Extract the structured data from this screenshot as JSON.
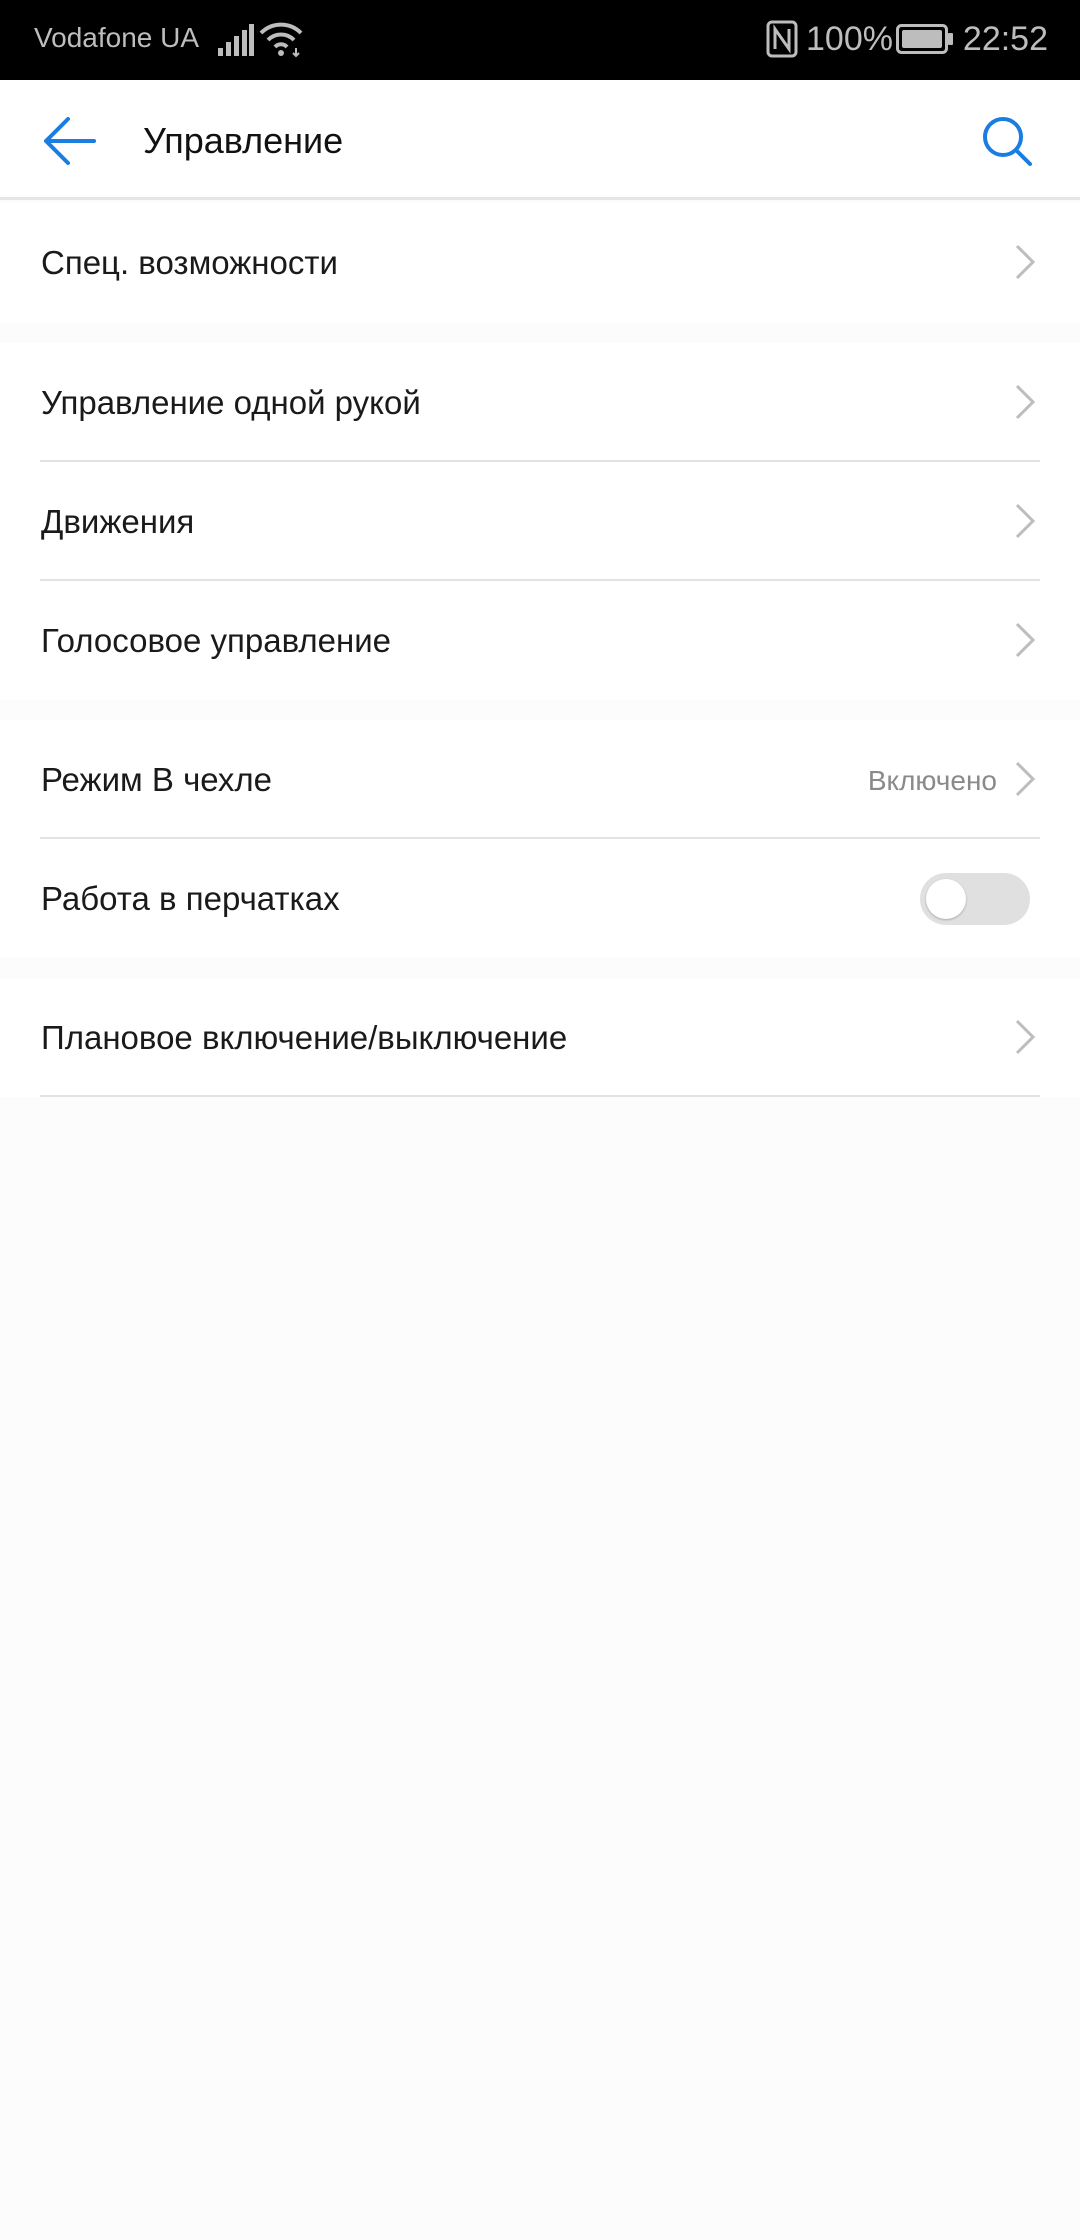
{
  "status_bar": {
    "carrier": "Vodafone UA",
    "battery_percent": "100%",
    "time": "22:52",
    "icons": [
      "signal-icon",
      "wifi-icon",
      "nfc-icon",
      "battery-icon"
    ]
  },
  "app_bar": {
    "title": "Управление",
    "back_icon": "arrow-left-icon",
    "search_icon": "search-icon"
  },
  "colors": {
    "accent": "#1a7de0",
    "status_bar_bg": "#000000",
    "background": "#fcfcfc",
    "group_gap": "#f4f4f4"
  },
  "groups": [
    {
      "items": [
        {
          "label": "Спец. возможности"
        }
      ]
    },
    {
      "items": [
        {
          "label": "Управление одной рукой"
        },
        {
          "label": "Движения"
        },
        {
          "label": "Голосовое управление"
        }
      ]
    },
    {
      "items": [
        {
          "label": "Режим В чехле",
          "value": "Включено"
        },
        {
          "label": "Работа в перчатках",
          "toggle_on": false
        }
      ]
    },
    {
      "items": [
        {
          "label": "Плановое включение/выключение"
        }
      ]
    }
  ]
}
